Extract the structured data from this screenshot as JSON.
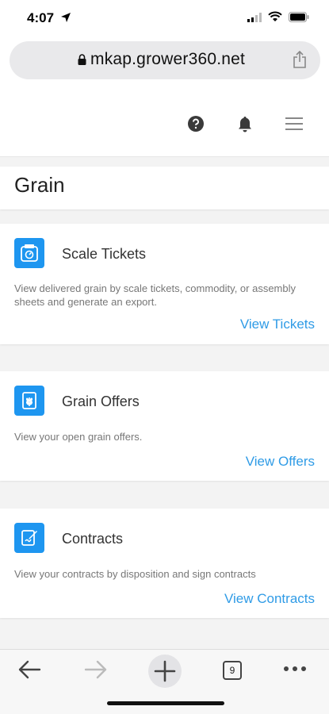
{
  "status_bar": {
    "time": "4:07"
  },
  "browser": {
    "url": "mkap.grower360.net",
    "tab_count": "9"
  },
  "header": {
    "icons": [
      "help-icon",
      "bell-icon",
      "hamburger-menu-icon"
    ]
  },
  "page": {
    "title": "Grain"
  },
  "cards": [
    {
      "title": "Scale Tickets",
      "description": "View delivered grain by scale tickets, commodity, or assembly sheets and generate an export.",
      "link": "View Tickets",
      "icon": "scale-icon"
    },
    {
      "title": "Grain Offers",
      "description": "View your open grain offers.",
      "link": "View Offers",
      "icon": "grain-icon"
    },
    {
      "title": "Contracts",
      "description": "View your contracts by disposition and sign contracts",
      "link": "View Contracts",
      "icon": "contract-sign-icon"
    }
  ],
  "colors": {
    "accent": "#1e96f0",
    "link": "#2f9be6",
    "page_background": "#f3f3f3"
  }
}
